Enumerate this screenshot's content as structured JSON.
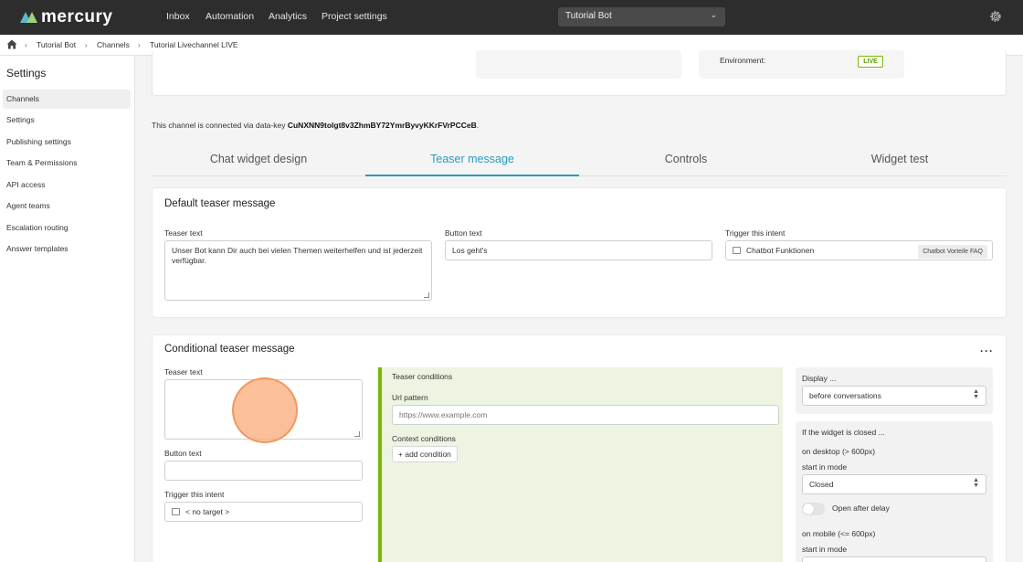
{
  "topbar": {
    "logo_text": "mercury",
    "nav": [
      "Inbox",
      "Automation",
      "Analytics",
      "Project settings"
    ],
    "bot_select": "Tutorial Bot"
  },
  "breadcrumb": [
    "Tutorial Bot",
    "Channels",
    "Tutorial Livechannel LIVE"
  ],
  "sidebar": {
    "title": "Settings",
    "items": [
      "Channels",
      "Settings",
      "Publishing settings",
      "Team & Permissions",
      "API access",
      "Agent teams",
      "Escalation routing",
      "Answer templates"
    ],
    "active": "Channels"
  },
  "environment": {
    "label": "Environment:",
    "badge": "LIVE"
  },
  "connected": {
    "prefix": "This channel is connected via data-key ",
    "key": "CuNXNN9tolgt8v3ZhmBY72YmrByvyKKrFVrPCCeB",
    "suffix": "."
  },
  "tabs": [
    "Chat widget design",
    "Teaser message",
    "Controls",
    "Widget test"
  ],
  "active_tab": "Teaser message",
  "default_teaser": {
    "title": "Default teaser message",
    "teaser_label": "Teaser text",
    "teaser_value": "Unser Bot kann Dir auch bei vielen Themen weiterhelfen und ist jederzeit  verfügbar.",
    "button_label": "Button text",
    "button_value": "Los geht's",
    "intent_label": "Trigger this intent",
    "intent_value": "Chatbot Funktionen",
    "intent_tag": "Chatbot Vorteile FAQ"
  },
  "conditional_teaser": {
    "title": "Conditional teaser message",
    "more": "···",
    "teaser_label": "Teaser text",
    "teaser_value": "",
    "button_label": "Button text",
    "button_value": "",
    "intent_label": "Trigger this intent",
    "intent_value": "< no target >",
    "conditions": {
      "title": "Teaser conditions",
      "url_label": "Url pattern",
      "url_placeholder": "https://www.example.com",
      "context_label": "Context conditions",
      "add_condition": "add condition"
    },
    "display": {
      "label": "Display ...",
      "value": "before conversations"
    },
    "closed_panel": {
      "title": "If the widget is closed ...",
      "desktop_label": "on desktop (> 600px)",
      "start_mode_label": "start in mode",
      "desktop_mode": "Closed",
      "open_after_delay": "Open after delay",
      "open_after_delay_on": false,
      "mobile_label": "on mobile (<= 600px)",
      "mobile_start_mode_label": "start in mode"
    }
  },
  "colors": {
    "accent": "#2a9bbd",
    "live_green": "#7ab800",
    "topbar": "#2d2d2d"
  },
  "icons": {
    "settings": "gear-icon",
    "home": "home-icon",
    "chevron": "chevron-right-icon"
  }
}
